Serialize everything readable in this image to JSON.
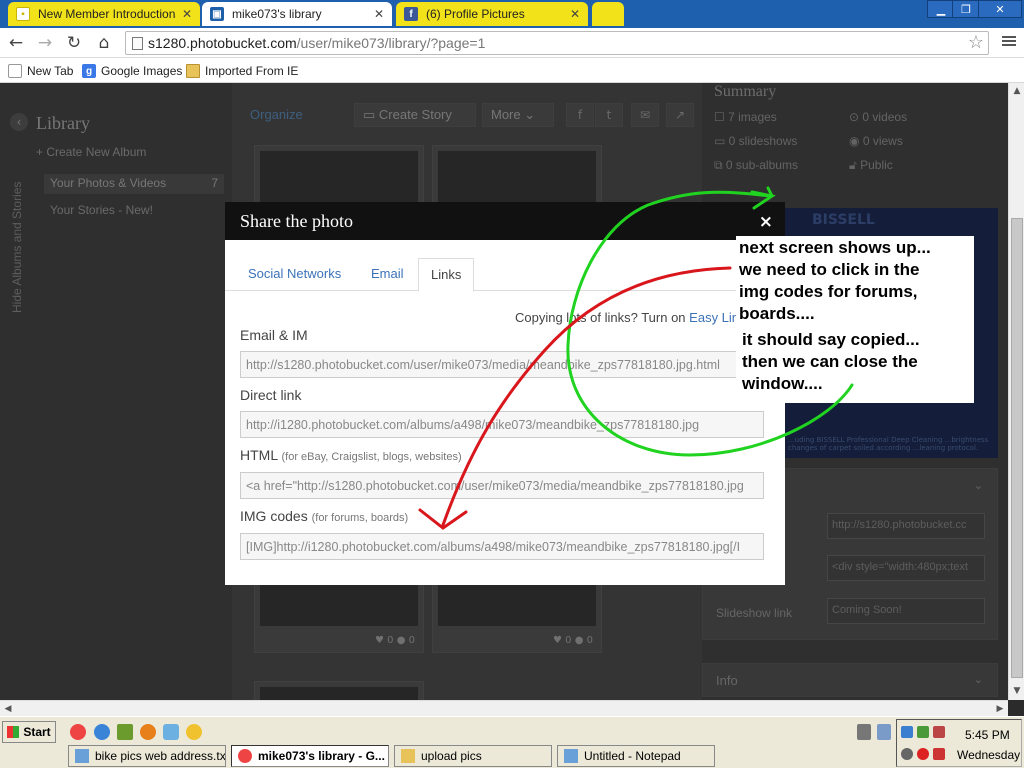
{
  "browser": {
    "tabs": [
      {
        "label": "New Member Introductions -",
        "active": false
      },
      {
        "label": "mike073's library",
        "active": true
      },
      {
        "label": "(6) Profile Pictures",
        "active": false
      }
    ],
    "url_host": "s1280.photobucket.com",
    "url_path": "/user/mike073/library/?page=1",
    "bookmarks": [
      "New Tab",
      "Google Images",
      "Imported From IE"
    ]
  },
  "library": {
    "title": "Library",
    "hide_albums": "Hide Albums and Stories",
    "create_album": "+ Create New Album",
    "your_photos": "Your Photos & Videos",
    "your_photos_count": "7",
    "your_stories": "Your Stories - New!",
    "organize": "Organize",
    "create_story": "Create Story",
    "more": "More",
    "thumb_stats": [
      "0",
      "0"
    ]
  },
  "summary": {
    "title": "Summary",
    "images": "7 images",
    "videos": "0 videos",
    "slideshows": "0 slideshows",
    "views": "0 views",
    "subalbums": "0 sub-albums",
    "privacy": "Public",
    "ad_title": "BISSELL",
    "ad_foot": "...uding BISSELL Professional Deep Cleaning ...brightness changes of carpet soiled according ...leaning protocol.",
    "field1": "http://s1280.photobucket.cc",
    "field2": "<div style=\"width:480px;text",
    "slideshow_label": "Slideshow link",
    "slideshow_value": "Coming Soon!",
    "info": "Info"
  },
  "modal": {
    "title": "Share the photo",
    "close": "×",
    "tabs": [
      "Social Networks",
      "Email",
      "Links"
    ],
    "copy_note": "Copying lots of links? Turn on",
    "copy_link": "Easy Lin",
    "email_im_label": "Email & IM",
    "email_im_value": "http://s1280.photobucket.com/user/mike073/media/meandbike_zps77818180.jpg.html",
    "direct_label": "Direct link",
    "direct_value": "http://i1280.photobucket.com/albums/a498/mike073/meandbike_zps77818180.jpg",
    "html_label": "HTML",
    "html_sub": "(for eBay, Craigslist, blogs, websites)",
    "html_value": "<a href=\"http://s1280.photobucket.com/user/mike073/media/meandbike_zps77818180.jpg",
    "img_label": "IMG codes",
    "img_sub": "(for forums, boards)",
    "img_value": "[IMG]http://i1280.photobucket.com/albums/a498/mike073/meandbike_zps77818180.jpg[/I"
  },
  "annotation": {
    "line1": "next screen shows up...\nwe need to click in the\nimg codes for forums,\nboards....",
    "line2": "it should say copied...\nthen we can close the\nwindow...."
  },
  "taskbar": {
    "start": "Start",
    "tasks": [
      "bike pics web address.tx...",
      "mike073's library - G...",
      "upload pics",
      "Untitled - Notepad"
    ],
    "time": "5:45 PM",
    "day": "Wednesday"
  },
  "colors": {
    "annotation_green": "#21d321",
    "annotation_red": "#d8161b",
    "link_blue": "#3b72b8"
  }
}
